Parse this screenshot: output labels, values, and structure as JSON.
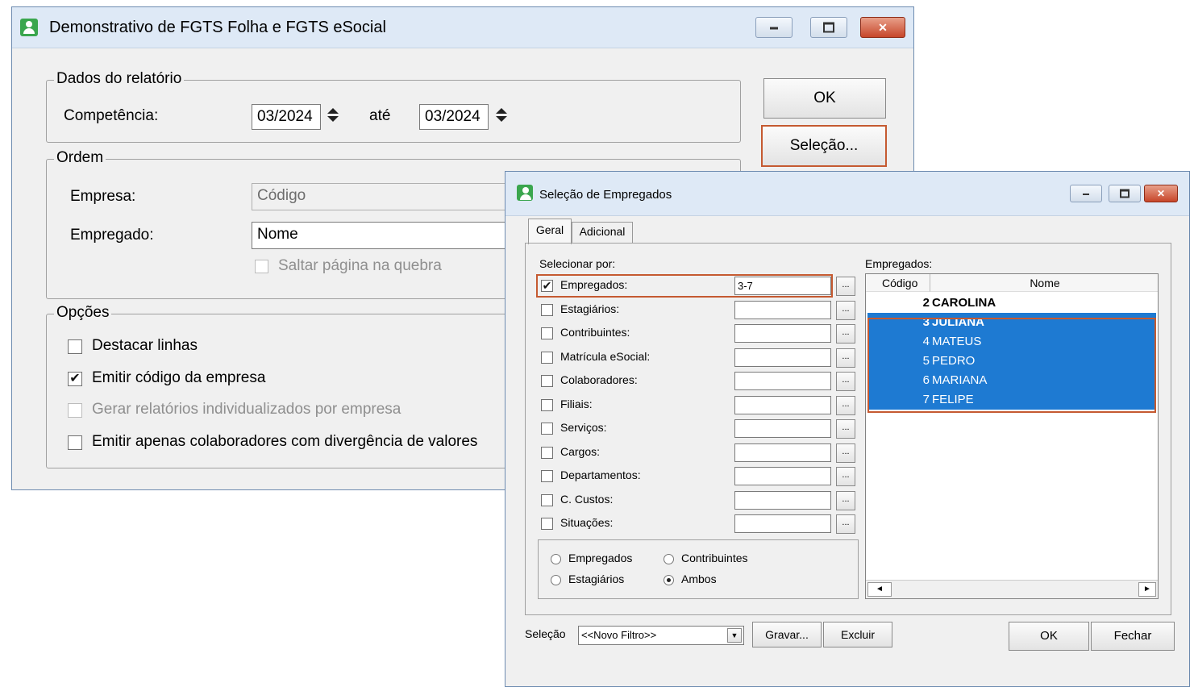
{
  "main_window": {
    "title": "Demonstrativo de FGTS Folha e FGTS eSocial",
    "dados": {
      "legend": "Dados do relatório",
      "competencia_label": "Competência:",
      "from_value": "03/2024",
      "ate_label": "até",
      "to_value": "03/2024"
    },
    "ordem": {
      "legend": "Ordem",
      "empresa_label": "Empresa:",
      "empresa_value": "Código",
      "empregado_label": "Empregado:",
      "empregado_value": "Nome",
      "saltar_label": "Saltar página na quebra"
    },
    "opcoes": {
      "legend": "Opções",
      "items": [
        {
          "label": "Destacar linhas",
          "checked": false,
          "disabled": false
        },
        {
          "label": "Emitir código da empresa",
          "checked": true,
          "disabled": false
        },
        {
          "label": "Gerar relatórios individualizados por empresa",
          "checked": false,
          "disabled": true
        },
        {
          "label": "Emitir apenas colaboradores com divergência de valores",
          "checked": false,
          "disabled": false
        }
      ]
    },
    "ok_label": "OK",
    "selecao_label": "Seleção..."
  },
  "selection_window": {
    "title": "Seleção de Empregados",
    "tabs": [
      "Geral",
      "Adicional"
    ],
    "selecionar_por": "Selecionar por:",
    "criteria": [
      {
        "label": "Empregados:",
        "checked": true,
        "value": "3-7"
      },
      {
        "label": "Estagiários:",
        "checked": false,
        "value": ""
      },
      {
        "label": "Contribuintes:",
        "checked": false,
        "value": ""
      },
      {
        "label": "Matrícula eSocial:",
        "checked": false,
        "value": ""
      },
      {
        "label": "Colaboradores:",
        "checked": false,
        "value": ""
      },
      {
        "label": "Filiais:",
        "checked": false,
        "value": ""
      },
      {
        "label": "Serviços:",
        "checked": false,
        "value": ""
      },
      {
        "label": "Cargos:",
        "checked": false,
        "value": ""
      },
      {
        "label": "Departamentos:",
        "checked": false,
        "value": ""
      },
      {
        "label": "C. Custos:",
        "checked": false,
        "value": ""
      },
      {
        "label": "Situações:",
        "checked": false,
        "value": ""
      }
    ],
    "dots_label": "...",
    "radios": [
      {
        "label": "Empregados",
        "checked": false
      },
      {
        "label": "Contribuintes",
        "checked": false
      },
      {
        "label": "Estagiários",
        "checked": false
      },
      {
        "label": "Ambos",
        "checked": true
      }
    ],
    "empregados_label": "Empregados:",
    "list_headers": {
      "codigo": "Código",
      "nome": "Nome"
    },
    "list_rows": [
      {
        "codigo": "2",
        "nome": "CAROLINA",
        "selected": false
      },
      {
        "codigo": "3",
        "nome": "JULIANA",
        "selected": true
      },
      {
        "codigo": "4",
        "nome": "MATEUS",
        "selected": true
      },
      {
        "codigo": "5",
        "nome": "PEDRO",
        "selected": true
      },
      {
        "codigo": "6",
        "nome": "MARIANA",
        "selected": true
      },
      {
        "codigo": "7",
        "nome": "FELIPE",
        "selected": true
      }
    ],
    "selecao_label": "Seleção",
    "filter_value": "<<Novo Filtro>>",
    "gravar_label": "Gravar...",
    "excluir_label": "Excluir",
    "ok_label": "OK",
    "fechar_label": "Fechar"
  },
  "colors": {
    "highlight": "#c55a31",
    "selection": "#1e7ad2"
  }
}
